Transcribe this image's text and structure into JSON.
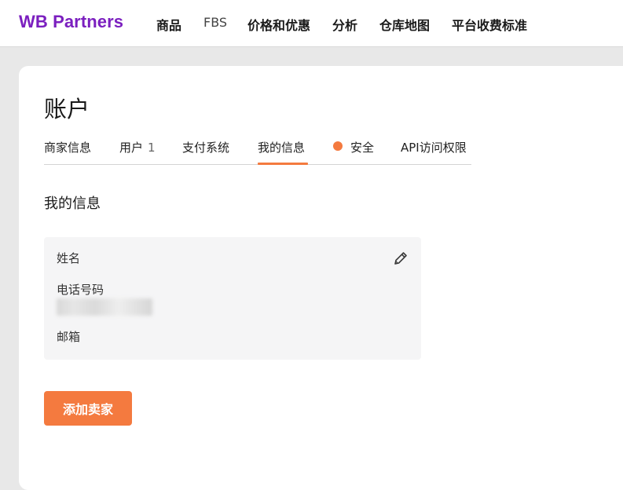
{
  "header": {
    "logo": "WB Partners",
    "nav": [
      {
        "label": "商品"
      },
      {
        "label": "FBS"
      },
      {
        "label": "价格和优惠"
      },
      {
        "label": "分析"
      },
      {
        "label": "仓库地图"
      },
      {
        "label": "平台收费标准"
      }
    ]
  },
  "page": {
    "title": "账户",
    "tabs": [
      {
        "label": "商家信息"
      },
      {
        "label": "用户",
        "count": "1"
      },
      {
        "label": "支付系统"
      },
      {
        "label": "我的信息",
        "active": true
      },
      {
        "label": "安全",
        "indicator": "#f47a3f"
      },
      {
        "label": "API访问权限"
      }
    ]
  },
  "my_info": {
    "section_title": "我的信息",
    "fields": {
      "name_label": "姓名",
      "phone_label": "电话号码",
      "email_label": "邮箱"
    },
    "edit_icon": "pencil-icon"
  },
  "actions": {
    "add_seller_label": "添加卖家"
  },
  "colors": {
    "brand": "#7b1fbf",
    "accent": "#f47a3f",
    "panel": "#f5f5f6"
  }
}
